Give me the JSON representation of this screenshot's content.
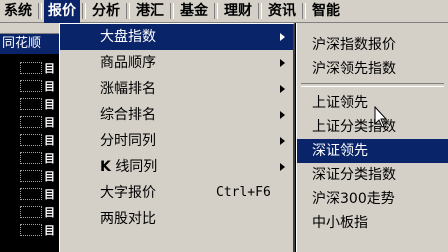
{
  "menubar": {
    "items": [
      "系统",
      "报价",
      "分析",
      "港汇",
      "基金",
      "理财",
      "资讯",
      "智能"
    ]
  },
  "background_window": {
    "title": "同花顺",
    "row_glyph": "目"
  },
  "dropdown": {
    "items": [
      {
        "label": "大盘指数",
        "submenu": true,
        "highlighted": true
      },
      {
        "label": "商品顺序",
        "submenu": true
      },
      {
        "label": "涨幅排名",
        "submenu": true
      },
      {
        "label": "综合排名",
        "submenu": true
      },
      {
        "label": "分时同列",
        "submenu": true
      },
      {
        "label_prefix": "K",
        "label": "线同列",
        "submenu": true
      },
      {
        "label": "大字报价",
        "shortcut": "Ctrl+F6"
      },
      {
        "label": "两股对比"
      }
    ]
  },
  "submenu": {
    "group1": [
      "沪深指数报价",
      "沪深领先指数"
    ],
    "group2": [
      "上证领先",
      "上证分类指数",
      "深证领先",
      "深证分类指数",
      "沪深300走势",
      "中小板指"
    ],
    "highlighted": "深证领先"
  },
  "colors": {
    "menu_bg": "#d4d0c8",
    "highlight": "#0a246a",
    "background": "#000000"
  }
}
